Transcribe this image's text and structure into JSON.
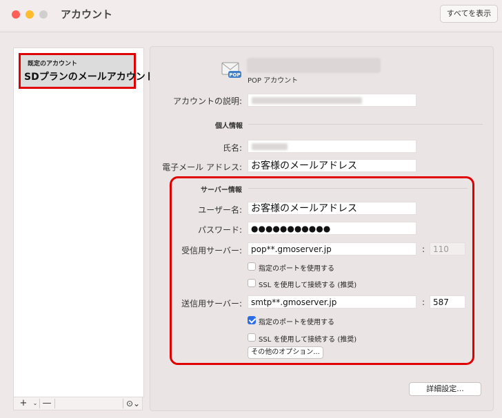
{
  "window": {
    "title": "アカウント",
    "show_all_label": "すべてを表示"
  },
  "sidebar": {
    "items": [
      {
        "type_label": "既定のアカウント",
        "name": "SDプランのメールアカウント"
      }
    ],
    "bottom": {
      "add_label": "+",
      "add_caret": "⌄",
      "remove_label": "—",
      "more_label": "⊙⌄"
    }
  },
  "account_header": {
    "icon_badge": "POP",
    "type_label": "POP アカウント"
  },
  "fields": {
    "description_label": "アカウントの説明:",
    "personal_section": "個人情報",
    "fullname_label": "氏名:",
    "email_label": "電子メール アドレス:",
    "email_value": "お客様のメールアドレス"
  },
  "server": {
    "section": "サーバー情報",
    "username_label": "ユーザー名:",
    "username_value": "お客様のメールアドレス",
    "password_label": "パスワード:",
    "password_value": "●●●●●●●●●●●",
    "incoming_label": "受信用サーバー:",
    "incoming_value": "pop**.gmoserver.jp",
    "incoming_colon": ":",
    "incoming_port": "110",
    "incoming_custom_port_label": "指定のポートを使用する",
    "incoming_custom_port_checked": false,
    "incoming_ssl_label": "SSL を使用して接続する (推奨)",
    "incoming_ssl_checked": false,
    "outgoing_label": "送信用サーバー:",
    "outgoing_value": "smtp**.gmoserver.jp",
    "outgoing_colon": ":",
    "outgoing_port": "587",
    "outgoing_custom_port_label": "指定のポートを使用する",
    "outgoing_custom_port_checked": true,
    "outgoing_ssl_label": "SSL を使用して接続する (推奨)",
    "outgoing_ssl_checked": false,
    "more_options_label": "その他のオプション..."
  },
  "advanced_button_label": "詳細設定...",
  "colors": {
    "highlight_red": "#e00000",
    "checkbox_blue": "#2c6de6"
  }
}
